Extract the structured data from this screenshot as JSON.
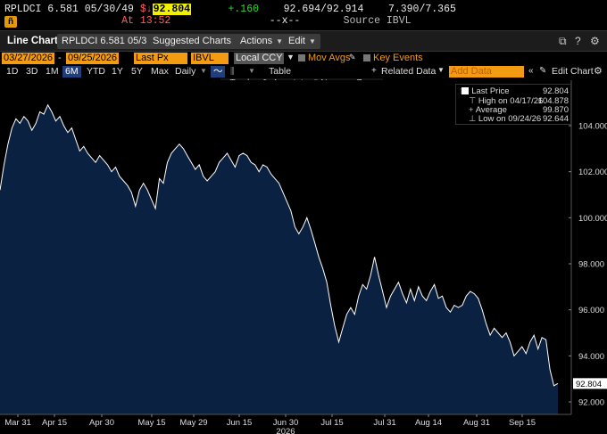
{
  "quote": {
    "ticker": "RPLDCI 6.581 05/30/49",
    "arrow": "$↓",
    "last": "92.804",
    "change": "+.160",
    "bid_ask": "92.694/92.914",
    "yield": "7.390/7.365",
    "time": "At 13:52",
    "size": "--x--",
    "source": "Source IBVL",
    "icon_label": "ñ"
  },
  "toolbar": {
    "title": "Line Chart",
    "security": "RPLDCI 6.581 05/3",
    "suggested": "Suggested Charts",
    "actions": "Actions",
    "edit": "Edit",
    "icons": [
      "external-link-icon",
      "help-icon",
      "settings-icon"
    ]
  },
  "fields": {
    "start_date": "03/27/2026",
    "end_date": "09/25/2026",
    "field": "Last Px",
    "source": "IBVL",
    "currency": "Local CCY",
    "mov_avgs": "Mov Avgs",
    "key_events": "Key Events",
    "related_data": "Related Data",
    "add_data_placeholder": "Add Data",
    "edit_chart": "Edit Chart"
  },
  "ranges": {
    "items": [
      "1D",
      "3D",
      "1M",
      "6M",
      "YTD",
      "1Y",
      "5Y",
      "Max"
    ],
    "active": "6M",
    "frequency": "Daily",
    "table": "Table"
  },
  "tools": {
    "track": "Track",
    "annotate": "Annotate",
    "news": "News",
    "zoom": "Zoom"
  },
  "legend": {
    "last_price_label": "Last Price",
    "last_price_value": "92.804",
    "high_label": "High on 04/17/26",
    "high_value": "104.878",
    "average_label": "Average",
    "average_value": "99.870",
    "low_label": "Low on 09/24/26",
    "low_value": "92.644"
  },
  "colors": {
    "area_fill": "#0b2141",
    "line": "#ffffff",
    "last_price_tag": "#ffffff",
    "accent_orange": "#f39c12"
  },
  "chart_data": {
    "type": "area",
    "title": "",
    "xlabel": "",
    "ylabel": "",
    "ylim": [
      91.6,
      106.0
    ],
    "y_ticks": [
      92,
      94,
      96,
      98,
      100,
      102,
      104
    ],
    "y_tick_labels": [
      "92.000",
      "94.000",
      "96.000",
      "98.000",
      "100.000",
      "102.000",
      "104.000"
    ],
    "x_tick_labels": [
      "Mar 31",
      "Apr 15",
      "Apr 30",
      "May 15",
      "May 29",
      "Jun 15",
      "Jun 30",
      "Jul 15",
      "Jul 31",
      "Aug 14",
      "Aug 31",
      "Sep 15"
    ],
    "x_year_label": "2026",
    "last_value_label": "92.804",
    "series": [
      {
        "values": [
          101.2,
          102.3,
          103.2,
          103.9,
          104.3,
          104.1,
          104.4,
          104.2,
          103.8,
          104.1,
          104.6,
          104.5,
          104.9,
          104.6,
          104.2,
          104.4,
          104.0,
          103.7,
          103.9,
          103.4,
          102.9,
          103.1,
          102.8,
          102.6,
          102.4,
          102.7,
          102.5,
          102.3,
          102.0,
          102.2,
          101.8,
          101.6,
          101.4,
          101.1,
          100.5,
          101.2,
          101.5,
          101.2,
          100.8,
          100.4,
          101.7,
          101.5,
          102.4,
          102.8,
          103.0,
          103.2,
          103.0,
          102.7,
          102.4,
          102.1,
          102.3,
          101.8,
          101.6,
          101.8,
          102.0,
          102.4,
          102.6,
          102.8,
          102.5,
          102.2,
          102.7,
          102.8,
          102.7,
          102.4,
          102.3,
          102.0,
          102.3,
          102.2,
          101.9,
          101.7,
          101.5,
          101.1,
          100.7,
          100.3,
          99.6,
          99.3,
          99.6,
          100.0,
          99.5,
          98.9,
          98.3,
          97.8,
          97.2,
          96.2,
          95.3,
          94.6,
          95.2,
          95.8,
          96.1,
          95.8,
          96.6,
          97.1,
          96.9,
          97.5,
          98.3,
          97.5,
          96.8,
          96.1,
          96.6,
          96.9,
          97.2,
          96.7,
          96.3,
          96.9,
          96.4,
          97.0,
          96.6,
          96.4,
          96.8,
          97.1,
          96.5,
          96.6,
          96.1,
          95.9,
          96.2,
          96.1,
          96.2,
          96.6,
          96.8,
          96.7,
          96.5,
          96.0,
          95.4,
          94.9,
          95.2,
          95.0,
          94.8,
          95.0,
          94.6,
          94.0,
          94.2,
          94.4,
          94.1,
          94.6,
          94.9,
          94.3,
          94.8,
          94.7,
          93.4,
          92.7,
          92.8
        ]
      }
    ]
  }
}
